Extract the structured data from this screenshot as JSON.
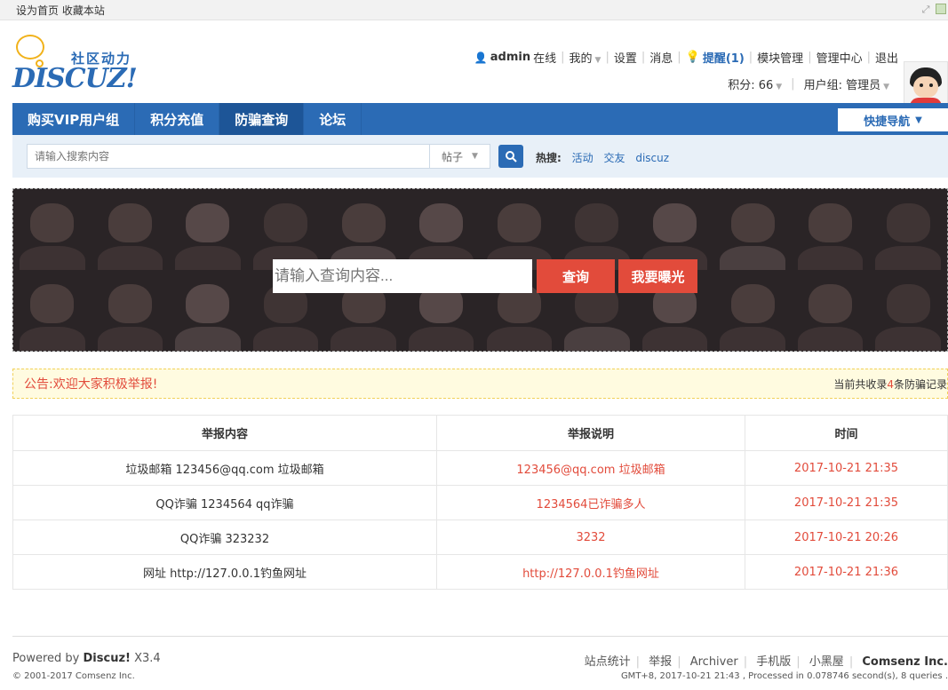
{
  "topbar": {
    "set_home": "设为首页",
    "bookmark": "收藏本站",
    "icons": [
      "resize-icon",
      "app-icon"
    ]
  },
  "logo": {
    "cn": "社区动力",
    "en": "DISCUZ!"
  },
  "user": {
    "name": "admin",
    "online": "在线",
    "mine": "我的",
    "settings": "设置",
    "messages": "消息",
    "remind": "提醒(1)",
    "module_manage": "模块管理",
    "admin_center": "管理中心",
    "logout": "退出",
    "points": "积分: 66",
    "group": "用户组: 管理员"
  },
  "nav": {
    "items": [
      {
        "label": "购买VIP用户组",
        "active": false
      },
      {
        "label": "积分充值",
        "active": false
      },
      {
        "label": "防骗查询",
        "active": true
      },
      {
        "label": "论坛",
        "active": false
      }
    ],
    "quick": "快捷导航"
  },
  "search": {
    "placeholder": "请输入搜索内容",
    "type": "帖子",
    "hot_label": "热搜:",
    "hot": [
      "活动",
      "交友",
      "discuz"
    ]
  },
  "banner": {
    "placeholder": "请输入查询内容...",
    "query_btn": "查询",
    "expose_btn": "我要曝光"
  },
  "notice": {
    "text": "公告:欢迎大家积极举报!",
    "count_prefix": "当前共收录",
    "count": "4",
    "count_suffix": "条防骗记录"
  },
  "table": {
    "headers": [
      "举报内容",
      "举报说明",
      "时间"
    ],
    "rows": [
      {
        "content": "垃圾邮箱  123456@qq.com 垃圾邮箱",
        "desc": "123456@qq.com 垃圾邮箱",
        "time": "2017-10-21 21:35"
      },
      {
        "content": "QQ诈骗  1234564 qq诈骗",
        "desc": "1234564已诈骗多人",
        "time": "2017-10-21 21:35"
      },
      {
        "content": "QQ诈骗  323232",
        "desc": "3232",
        "time": "2017-10-21 20:26"
      },
      {
        "content": "网址  http://127.0.0.1钓鱼网址",
        "desc": "http://127.0.0.1钓鱼网址",
        "time": "2017-10-21 21:36"
      }
    ]
  },
  "footer": {
    "powered": "Powered by",
    "brand": "Discuz!",
    "version": "X3.4",
    "copyright": "© 2001-2017 Comsenz Inc.",
    "links": [
      "站点统计",
      "举报",
      "Archiver",
      "手机版",
      "小黑屋"
    ],
    "company": "Comsenz Inc.",
    "stats": "GMT+8, 2017-10-21 21:43 , Processed in 0.078746 second(s), 8 queries ."
  },
  "colors": {
    "brand_blue": "#2b6bb5",
    "accent_red": "#e24b3b"
  }
}
